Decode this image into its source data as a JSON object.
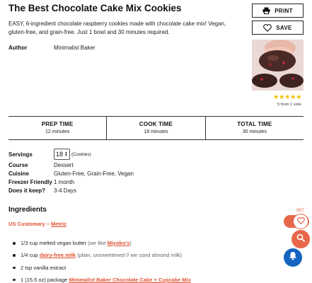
{
  "recipe": {
    "title": "The Best Chocolate Cake Mix Cookies",
    "description": "EASY, 6-ingredient chocolate raspberry cookies made with chocolate cake mix! Vegan, gluten-free, and grain-free. Just 1 bowl and 30 minutes required.",
    "author_label": "Author",
    "author": "Minimalist Baker"
  },
  "actions": {
    "print_label": "PRINT",
    "save_label": "SAVE"
  },
  "rating": {
    "stars": "★★★★★",
    "text": "5 from 1 vote",
    "value": 5
  },
  "times": [
    {
      "label": "PREP TIME",
      "value": "12 minutes"
    },
    {
      "label": "COOK TIME",
      "value": "18 minutes"
    },
    {
      "label": "TOTAL TIME",
      "value": "30 minutes"
    }
  ],
  "details": {
    "servings_label": "Servings",
    "servings_value": "18",
    "servings_unit": "(Cookies)",
    "course_label": "Course",
    "course": "Dessert",
    "cuisine_label": "Cuisine",
    "cuisine": "Gluten-Free, Grain-Free, Vegan",
    "freezer_label": "Freezer Friendly",
    "freezer": "1 month",
    "keep_label": "Does it keep?",
    "keep": "3-4 Days"
  },
  "ingredients": {
    "heading": "Ingredients",
    "units": {
      "customary": "US Customary",
      "separator": "–",
      "metric": "Metric"
    },
    "items": [
      {
        "text": "1/3 cup melted vegan butter",
        "note_pre": "(we like ",
        "link": "Miyoko's",
        "note_post": ")"
      },
      {
        "text": "1/4 cup ",
        "link": "dairy-free milk",
        "note": "(plain, unsweetened // we used almond milk)"
      },
      {
        "text": "2 tsp vanilla extract"
      },
      {
        "text": "1 (15.5 oz) package ",
        "link": "Minimalist Baker Chocolate Cake + Cupcake Mix"
      }
    ]
  },
  "floating": {
    "favorites_count": "857",
    "accent_color": "#e8674a",
    "bell_color": "#1565c0"
  }
}
